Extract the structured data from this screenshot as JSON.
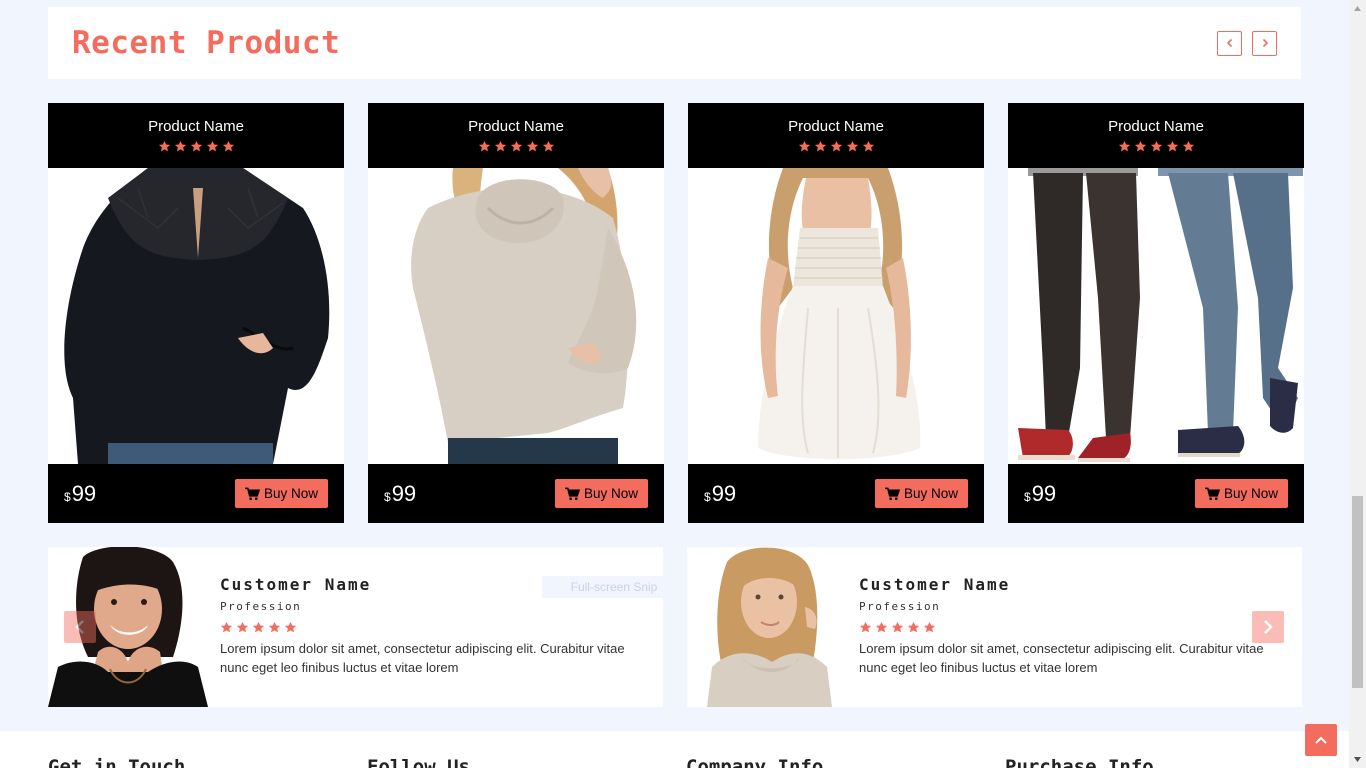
{
  "header": {
    "title": "Recent Product",
    "prev_icon": "chevron-left-icon",
    "next_icon": "chevron-right-icon"
  },
  "colors": {
    "accent": "#f36c5e",
    "card_bg": "#000000",
    "page_bg": "#f1f5fd"
  },
  "products": [
    {
      "name": "Product Name",
      "rating": 5,
      "currency": "$",
      "price": "99",
      "buy_label": "Buy Now",
      "image": "woman-black-lace-blouse"
    },
    {
      "name": "Product Name",
      "rating": 5,
      "currency": "$",
      "price": "99",
      "buy_label": "Buy Now",
      "image": "woman-beige-cowl-neck-sweater"
    },
    {
      "name": "Product Name",
      "rating": 5,
      "currency": "$",
      "price": "99",
      "buy_label": "Buy Now",
      "image": "woman-white-dress"
    },
    {
      "name": "Product Name",
      "rating": 5,
      "currency": "$",
      "price": "99",
      "buy_label": "Buy Now",
      "image": "two-people-jeans-boat-shoes"
    }
  ],
  "testimonials": [
    {
      "name": "Customer Name",
      "profession": "Profession",
      "rating": 5,
      "text": "Lorem ipsum dolor sit amet, consectetur adipiscing elit. Curabitur vitae nunc eget leo finibus luctus et vitae lorem",
      "avatar": "dark-haired-woman-smiling"
    },
    {
      "name": "Customer Name",
      "profession": "Profession",
      "rating": 5,
      "text": "Lorem ipsum dolor sit amet, consectetur adipiscing elit. Curabitur vitae nunc eget leo finibus luctus et vitae lorem",
      "avatar": "blonde-woman-beige-sweater"
    }
  ],
  "overlay_hint": "Full-screen Snip",
  "footer": {
    "columns": [
      "Get in Touch",
      "Follow Us",
      "Company Info",
      "Purchase Info"
    ]
  },
  "back_to_top_icon": "chevron-up-icon"
}
